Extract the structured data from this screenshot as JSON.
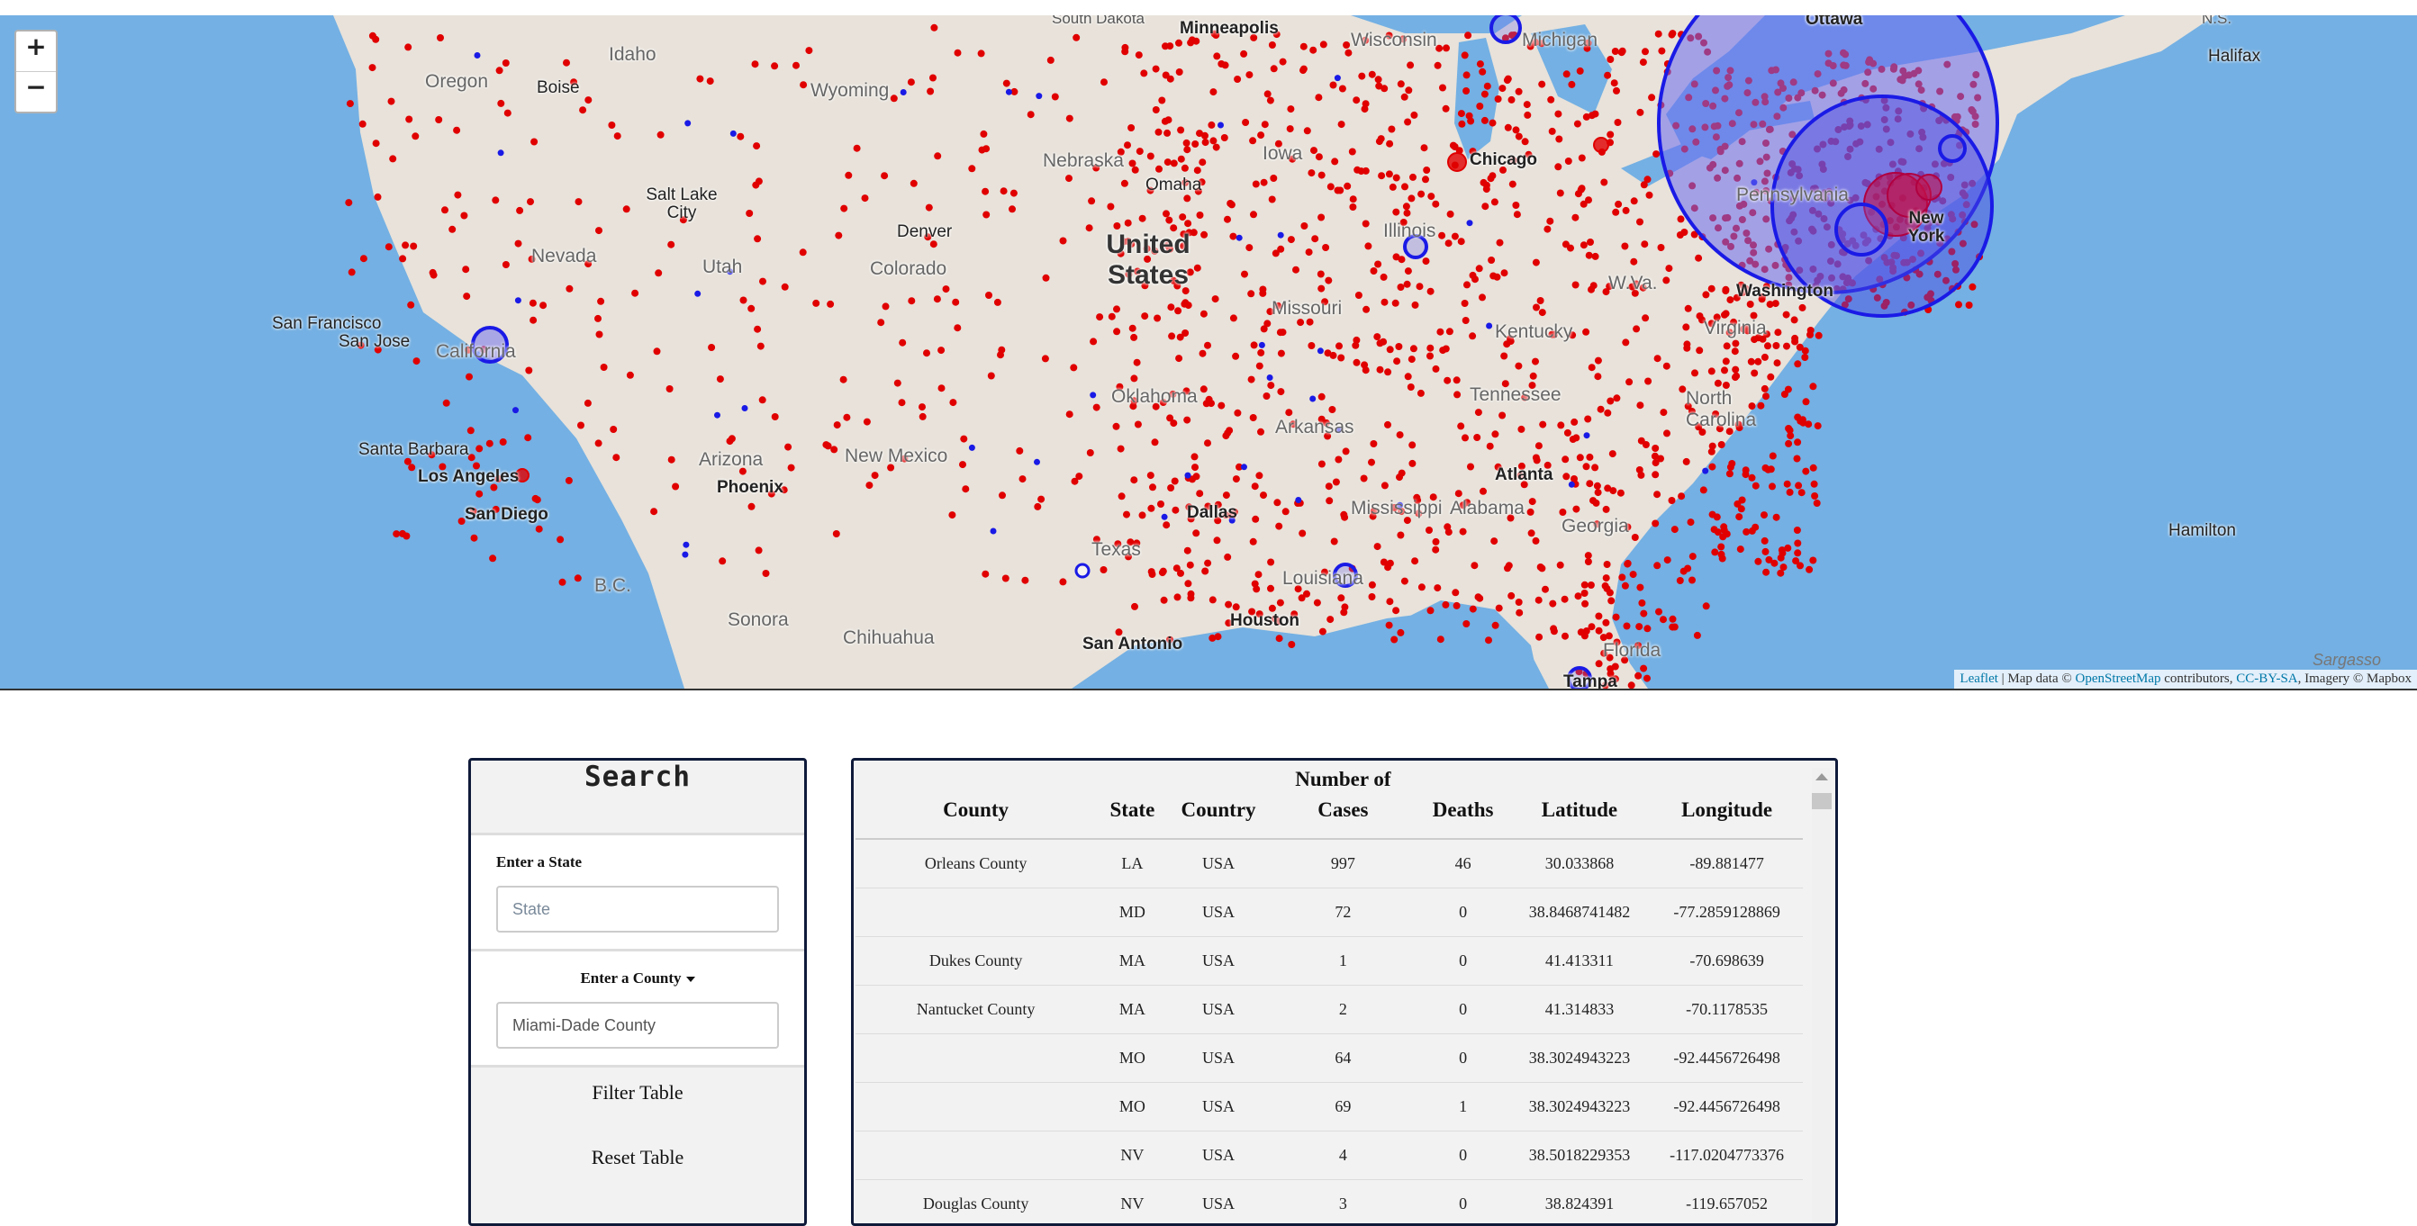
{
  "map": {
    "zoom_in": "+",
    "zoom_out": "−",
    "attribution": {
      "leaflet": "Leaflet",
      "sep1": " | Map data © ",
      "osm": "OpenStreetMap",
      "sep2": " contributors, ",
      "license": "CC-BY-SA",
      "sep3": ", Imagery © ",
      "imagery": "Mapbox"
    },
    "labels": {
      "south_dakota": "South Dakota",
      "minneapolis": "Minneapolis",
      "wisconsin": "Wisconsin",
      "michigan": "Michigan",
      "ottawa": "Ottawa",
      "ns": "N.S.",
      "halifax": "Halifax",
      "oregon": "Oregon",
      "idaho": "Idaho",
      "boise": "Boise",
      "wyoming": "Wyoming",
      "nebraska": "Nebraska",
      "omaha": "Omaha",
      "chicago": "Chicago",
      "iowa": "Iowa",
      "salt_lake": "Salt Lake City",
      "denver": "Denver",
      "colorado": "Colorado",
      "united_states": "United States",
      "illinois": "Illinois",
      "nevada": "Nevada",
      "utah": "Utah",
      "pennsylvania": "Pennsylvania",
      "new_york": "New York",
      "washington": "Washington",
      "wva": "W.Va.",
      "virginia": "Virginia",
      "kentucky": "Kentucky",
      "missouri": "Missouri",
      "san_francisco": "San Francisco",
      "san_jose": "San Jose",
      "california": "California",
      "santa_barbara": "Santa Barbara",
      "los_angeles": "Los Angeles",
      "san_diego": "San Diego",
      "arizona": "Arizona",
      "phoenix": "Phoenix",
      "new_mexico": "New Mexico",
      "oklahoma": "Oklahoma",
      "arkansas": "Arkansas",
      "tennessee": "Tennessee",
      "north_carolina": "North Carolina",
      "atlanta": "Atlanta",
      "georgia": "Georgia",
      "dallas": "Dallas",
      "mississippi": "Mississippi",
      "alabama": "Alabama",
      "texas": "Texas",
      "louisiana": "Louisiana",
      "houston": "Houston",
      "san_antonio": "San Antonio",
      "bc": "B.C.",
      "sonora": "Sonora",
      "chihuahua": "Chihuahua",
      "tampa": "Tampa",
      "florida": "Florida",
      "hamilton": "Hamilton",
      "sargasso": "Sargasso"
    }
  },
  "search": {
    "title": "Search",
    "state_label": "Enter a State",
    "state_placeholder": "State",
    "county_label": "Enter a County",
    "county_value": "Miami-Dade County",
    "filter_button": "Filter Table",
    "reset_button": "Reset Table"
  },
  "table": {
    "headers": [
      "County",
      "State",
      "Country",
      "Number of Cases",
      "Deaths",
      "Latitude",
      "Longitude"
    ],
    "rows": [
      [
        "Orleans County",
        "LA",
        "USA",
        "997",
        "46",
        "30.033868",
        "-89.881477"
      ],
      [
        "",
        "MD",
        "USA",
        "72",
        "0",
        "38.8468741482",
        "-77.2859128869"
      ],
      [
        "Dukes County",
        "MA",
        "USA",
        "1",
        "0",
        "41.413311",
        "-70.698639"
      ],
      [
        "Nantucket County",
        "MA",
        "USA",
        "2",
        "0",
        "41.314833",
        "-70.1178535"
      ],
      [
        "",
        "MO",
        "USA",
        "64",
        "0",
        "38.3024943223",
        "-92.4456726498"
      ],
      [
        "",
        "MO",
        "USA",
        "69",
        "1",
        "38.3024943223",
        "-92.4456726498"
      ],
      [
        "",
        "NV",
        "USA",
        "4",
        "0",
        "38.5018229353",
        "-117.0204773376"
      ],
      [
        "Douglas County",
        "NV",
        "USA",
        "3",
        "0",
        "38.824391",
        "-119.657052"
      ]
    ]
  },
  "colors": {
    "water": "#74b0e3",
    "land": "#e8e2da",
    "case_marker": "#e00000",
    "death_marker": "#1a1ae6",
    "panel_border": "#0f1a3a"
  }
}
